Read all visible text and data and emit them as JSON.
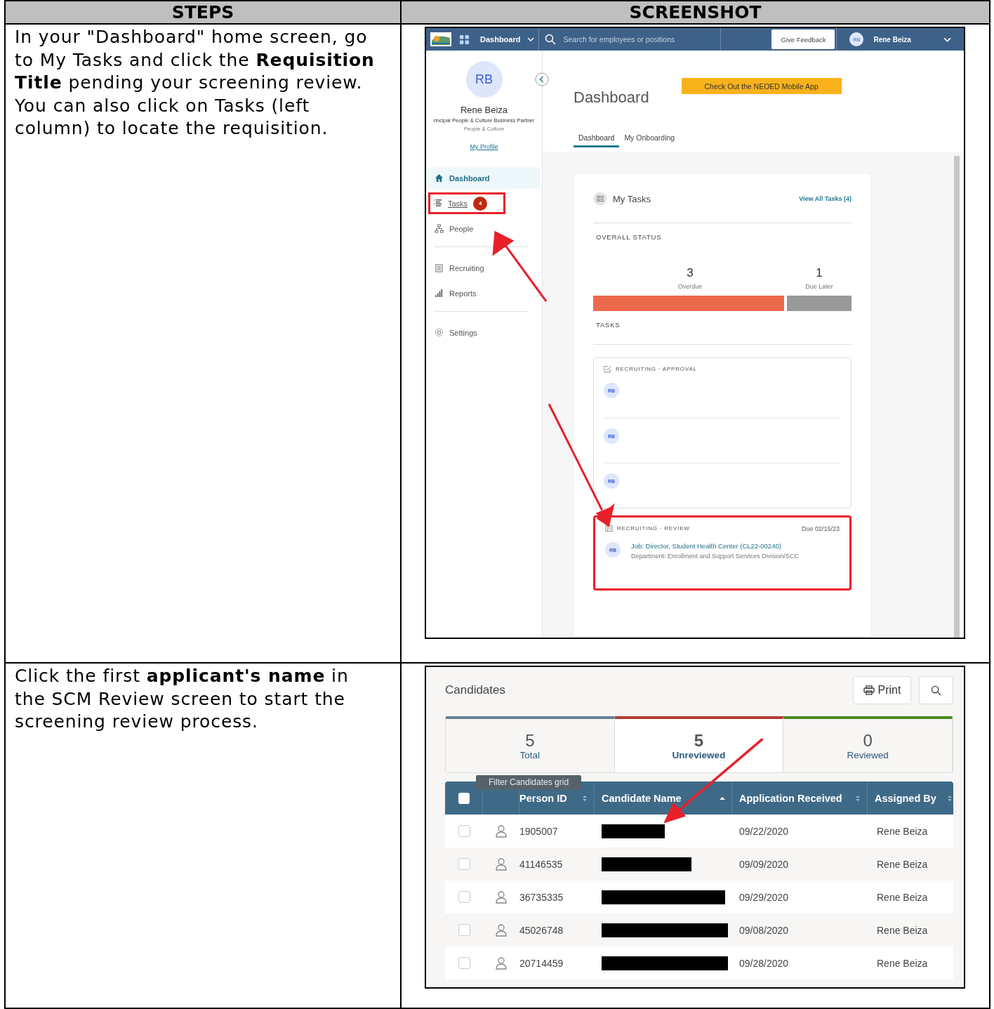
{
  "table": {
    "columns": [
      "STEPS",
      "SCREENSHOT"
    ]
  },
  "steps": [
    {
      "instruction": "In your \"Dashboard\" home screen, go to My Tasks and click the **Requisition Title** pending your screening review. You can also click on Tasks (left column) to locate the requisition."
    },
    {
      "instruction": "Click the first **applicant's name** in the SCM Review screen to start the screening review process."
    }
  ],
  "dashboard_screen": {
    "top_bar": {
      "app_name": "Dashboard",
      "search": {
        "placeholder": "Search for employees or positions"
      },
      "feedback_button": "Give Feedback",
      "user_initials": "RB",
      "user_name": "Rene Beiza"
    },
    "profile": {
      "initials": "RB",
      "name": "Rene Beiza",
      "title": "rincipal People & Culture Business Partner",
      "department": "People & Culture",
      "link": "My Profile"
    },
    "sidebar": {
      "items": [
        {
          "label": "Dashboard",
          "selected": true,
          "annotated": false
        },
        {
          "label": "Tasks",
          "selected": false,
          "annotated": true,
          "badge": "4"
        },
        {
          "label": "People",
          "selected": false,
          "annotated": false
        },
        {
          "label": "Recruiting",
          "selected": false,
          "annotated": false
        },
        {
          "label": "Reports",
          "selected": false,
          "annotated": false
        },
        {
          "label": "Settings",
          "selected": false,
          "annotated": false
        }
      ]
    },
    "banner": "Check Out the NEOED Mobile App",
    "page_title": "Dashboard",
    "tabs": [
      {
        "label": "Dashboard",
        "selected": true
      },
      {
        "label": "My Onboarding",
        "selected": false
      }
    ],
    "my_tasks": {
      "title": "My Tasks",
      "link": "View All Tasks (4)",
      "overall_status_label": "OVERALL STATUS",
      "stats": [
        {
          "value": "3",
          "label": "Overdue"
        },
        {
          "value": "1",
          "label": "Due Later"
        }
      ],
      "status_bar": {
        "level": 0.75
      },
      "tasks_label": "TASKS",
      "groups": [
        {
          "category": "RECRUITING · APPROVAL",
          "annotated": false,
          "items": [
            {
              "initials": "RB"
            },
            {
              "initials": "RB"
            },
            {
              "initials": "RB"
            }
          ]
        },
        {
          "category": "RECRUITING · REVIEW",
          "due": "Due 02/15/23",
          "annotated": true,
          "items": [
            {
              "initials": "RB",
              "title": "Job: Director, Student Health Center (CL22-00240)",
              "department": "Department: Enrollment and Support Services Division/SCC"
            }
          ]
        }
      ]
    }
  },
  "candidates_screen": {
    "title": "Candidates",
    "print_button": "Print",
    "summary": [
      {
        "value": "5",
        "label": "Total",
        "selected": false,
        "color": "#6b7f8e"
      },
      {
        "value": "5",
        "label": "Unreviewed",
        "selected": true,
        "color": "#b53a32"
      },
      {
        "value": "0",
        "label": "Reviewed",
        "selected": false,
        "color": "#4a8a1a"
      }
    ],
    "tooltip": "Filter Candidates grid",
    "select_all_checked": false,
    "columns": [
      {
        "label": "Person ID",
        "sorted": false
      },
      {
        "label": "Candidate Name",
        "sorted": true
      },
      {
        "label": "Application Received",
        "sorted": false
      },
      {
        "label": "Assigned By",
        "sorted": false
      }
    ],
    "rows": [
      {
        "person_id": "1905007",
        "received": "09/22/2020",
        "assigned_by": "Rene Beiza",
        "checked": false
      },
      {
        "person_id": "41146535",
        "received": "09/09/2020",
        "assigned_by": "Rene Beiza",
        "checked": false
      },
      {
        "person_id": "36735335",
        "received": "09/29/2020",
        "assigned_by": "Rene Beiza",
        "checked": false
      },
      {
        "person_id": "45026748",
        "received": "09/08/2020",
        "assigned_by": "Rene Beiza",
        "checked": false
      },
      {
        "person_id": "20714459",
        "received": "09/28/2020",
        "assigned_by": "Rene Beiza",
        "checked": false
      }
    ]
  }
}
